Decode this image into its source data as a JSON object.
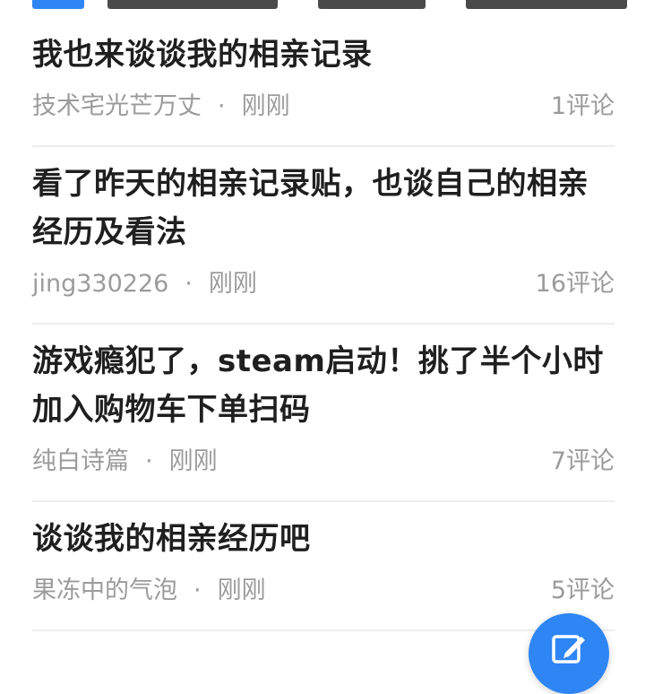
{
  "feed": {
    "items": [
      {
        "title": "我也来谈谈我的相亲记录",
        "author": "技术宅光芒万丈",
        "separator": "·",
        "time": "刚刚",
        "comments": "1评论"
      },
      {
        "title": "看了昨天的相亲记录贴，也谈自己的相亲经历及看法",
        "author": "jing330226",
        "separator": "·",
        "time": "刚刚",
        "comments": "16评论"
      },
      {
        "title": "游戏瘾犯了，steam启动！挑了半个小时加入购物车下单扫码",
        "author": "纯白诗篇",
        "separator": "·",
        "time": "刚刚",
        "comments": "7评论"
      },
      {
        "title": "谈谈我的相亲经历吧",
        "author": "果冻中的气泡",
        "separator": "·",
        "time": "刚刚",
        "comments": "5评论"
      }
    ]
  },
  "colors": {
    "title": "#1f1f1f",
    "meta": "#9b9b9b",
    "divider": "#ededed",
    "fab": "#2e86f5"
  },
  "fab": {
    "icon": "edit-icon"
  }
}
